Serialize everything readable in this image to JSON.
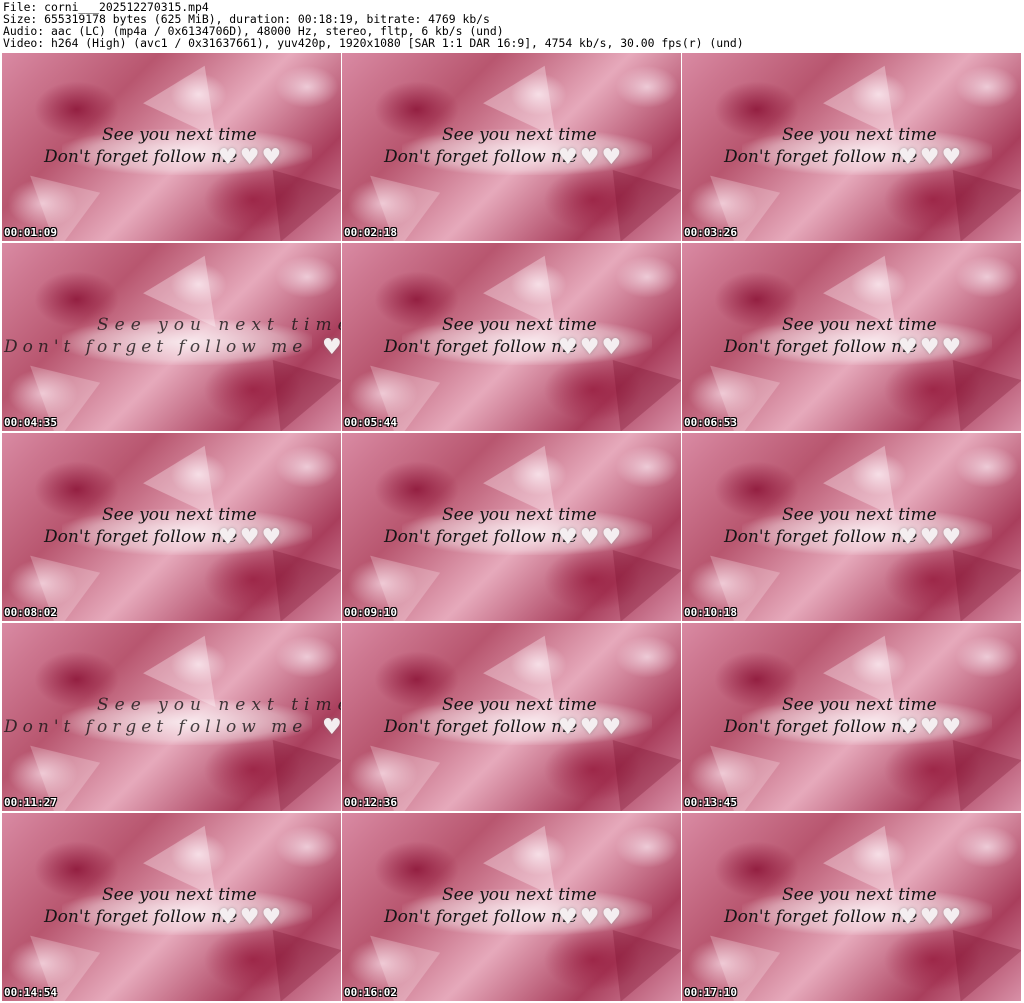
{
  "header": {
    "file_line": "File: corni___202512270315.mp4",
    "size_line": "Size: 655319178 bytes (625 MiB), duration: 00:18:19, bitrate: 4769 kb/s",
    "audio_line": "Audio: aac (LC) (mp4a / 0x6134706D), 48000 Hz, stereo, fltp, 6 kb/s (und)",
    "video_line": "Video: h264 (High) (avc1 / 0x31637661), yuv420p, 1920x1080 [SAR 1:1 DAR 16:9], 4754 kb/s, 30.00 fps(r) (und)"
  },
  "caption": {
    "line1": "See you next time",
    "line2": "Don't forget follow me",
    "hearts": "♥♥♥"
  },
  "caption_glitch_a": {
    "line1": "See you next time",
    "line2": "Don't forget follow me",
    "hearts": "♥"
  },
  "caption_glitch_b": {
    "line1": "See you next time",
    "line2": "Don't forget follow me",
    "hearts": "♥"
  },
  "timestamps": [
    "00:01:09",
    "00:02:18",
    "00:03:26",
    "00:04:35",
    "00:05:44",
    "00:06:53",
    "00:08:02",
    "00:09:10",
    "00:10:18",
    "00:11:27",
    "00:12:36",
    "00:13:45",
    "00:14:54",
    "00:16:02",
    "00:17:10"
  ],
  "colors": {
    "background_primary": "#b8566f",
    "background_dark": "#8c1437",
    "caption_text": "#151515",
    "heart": "#f4eef0"
  }
}
